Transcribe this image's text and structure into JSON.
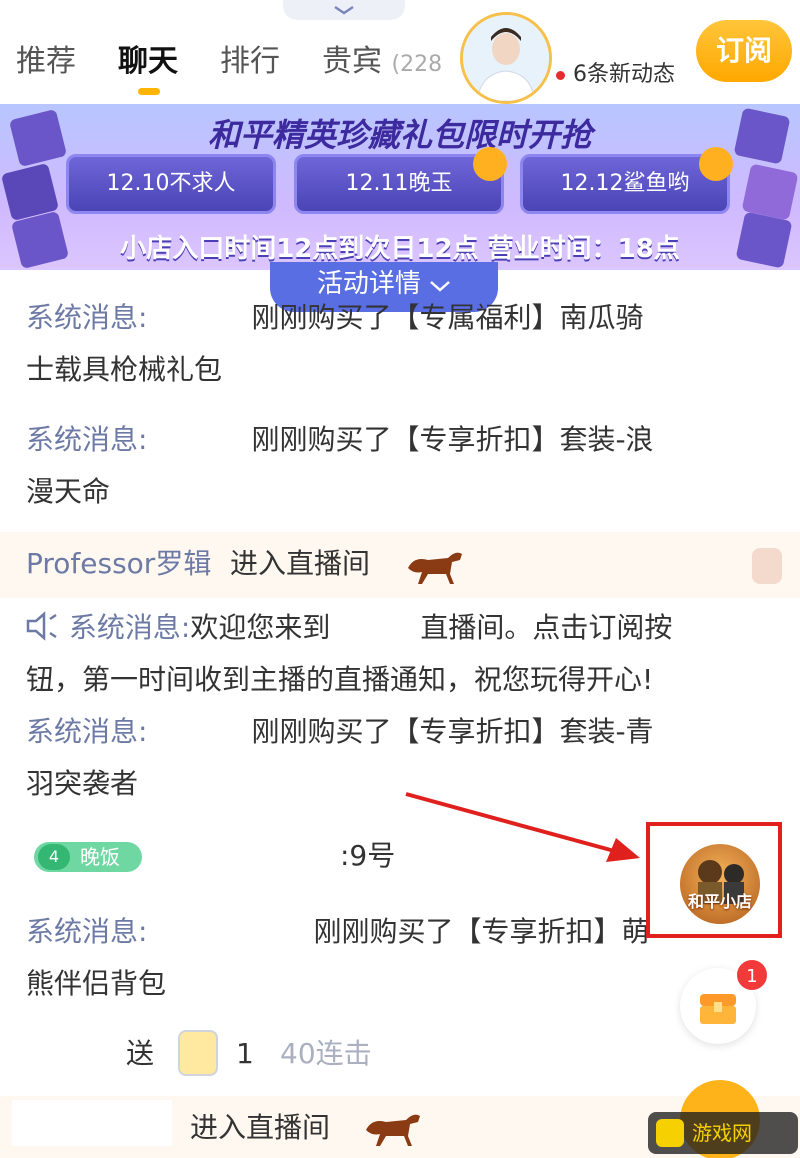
{
  "header": {
    "tabs": [
      {
        "label": "推荐"
      },
      {
        "label": "聊天"
      },
      {
        "label": "排行"
      },
      {
        "label": "贵宾"
      }
    ],
    "vip_count": "(228",
    "updates_text": "6条新动态",
    "subscribe_label": "订阅"
  },
  "banner": {
    "title": "和平精英珍藏礼包限时开抢",
    "buttons": [
      "12.10不求人",
      "12.11晚玉",
      "12.12鲨鱼哟"
    ],
    "note": "小店入口时间12点到次日12点 营业时间：18点",
    "detail_label": "活动详情"
  },
  "chat": {
    "m1_label": "系统消息:",
    "m1_text": "刚刚购买了【专属福利】南瓜骑",
    "m1_cont": "士载具枪械礼包",
    "m2_label": "系统消息:",
    "m2_text": "刚刚购买了【专享折扣】套装-浪",
    "m2_cont": "漫天命",
    "enter1_name": "Professor罗辑",
    "enter1_text": "进入直播间",
    "welcome_label": "系统消息:",
    "welcome_text_a": "欢迎您来到",
    "welcome_text_b": "直播间。点击订阅按",
    "welcome_cont": "钮，第一时间收到主播的直播通知，祝您玩得开心!",
    "m3_label": "系统消息:",
    "m3_text": "刚刚购买了【专享折扣】套装-青",
    "m3_cont": "羽突袭者",
    "level_num": "4",
    "level_name": "晚饭",
    "level_msg": ":9号",
    "m4_label": "系统消息:",
    "m4_text": "刚刚购买了【专享折扣】萌",
    "m4_cont": "熊伴侣背包",
    "gift_send": "送",
    "gift_count": "1",
    "gift_combo": "40连击",
    "enter2_text": "进入直播间"
  },
  "floating": {
    "shop_label": "和平小店",
    "chest_badge": "1",
    "watermark": "游戏网"
  },
  "colors": {
    "accent": "#ffb400",
    "system_text": "#6d7aa6",
    "highlight_box": "#e0201c",
    "arrow": "#e0201c"
  }
}
